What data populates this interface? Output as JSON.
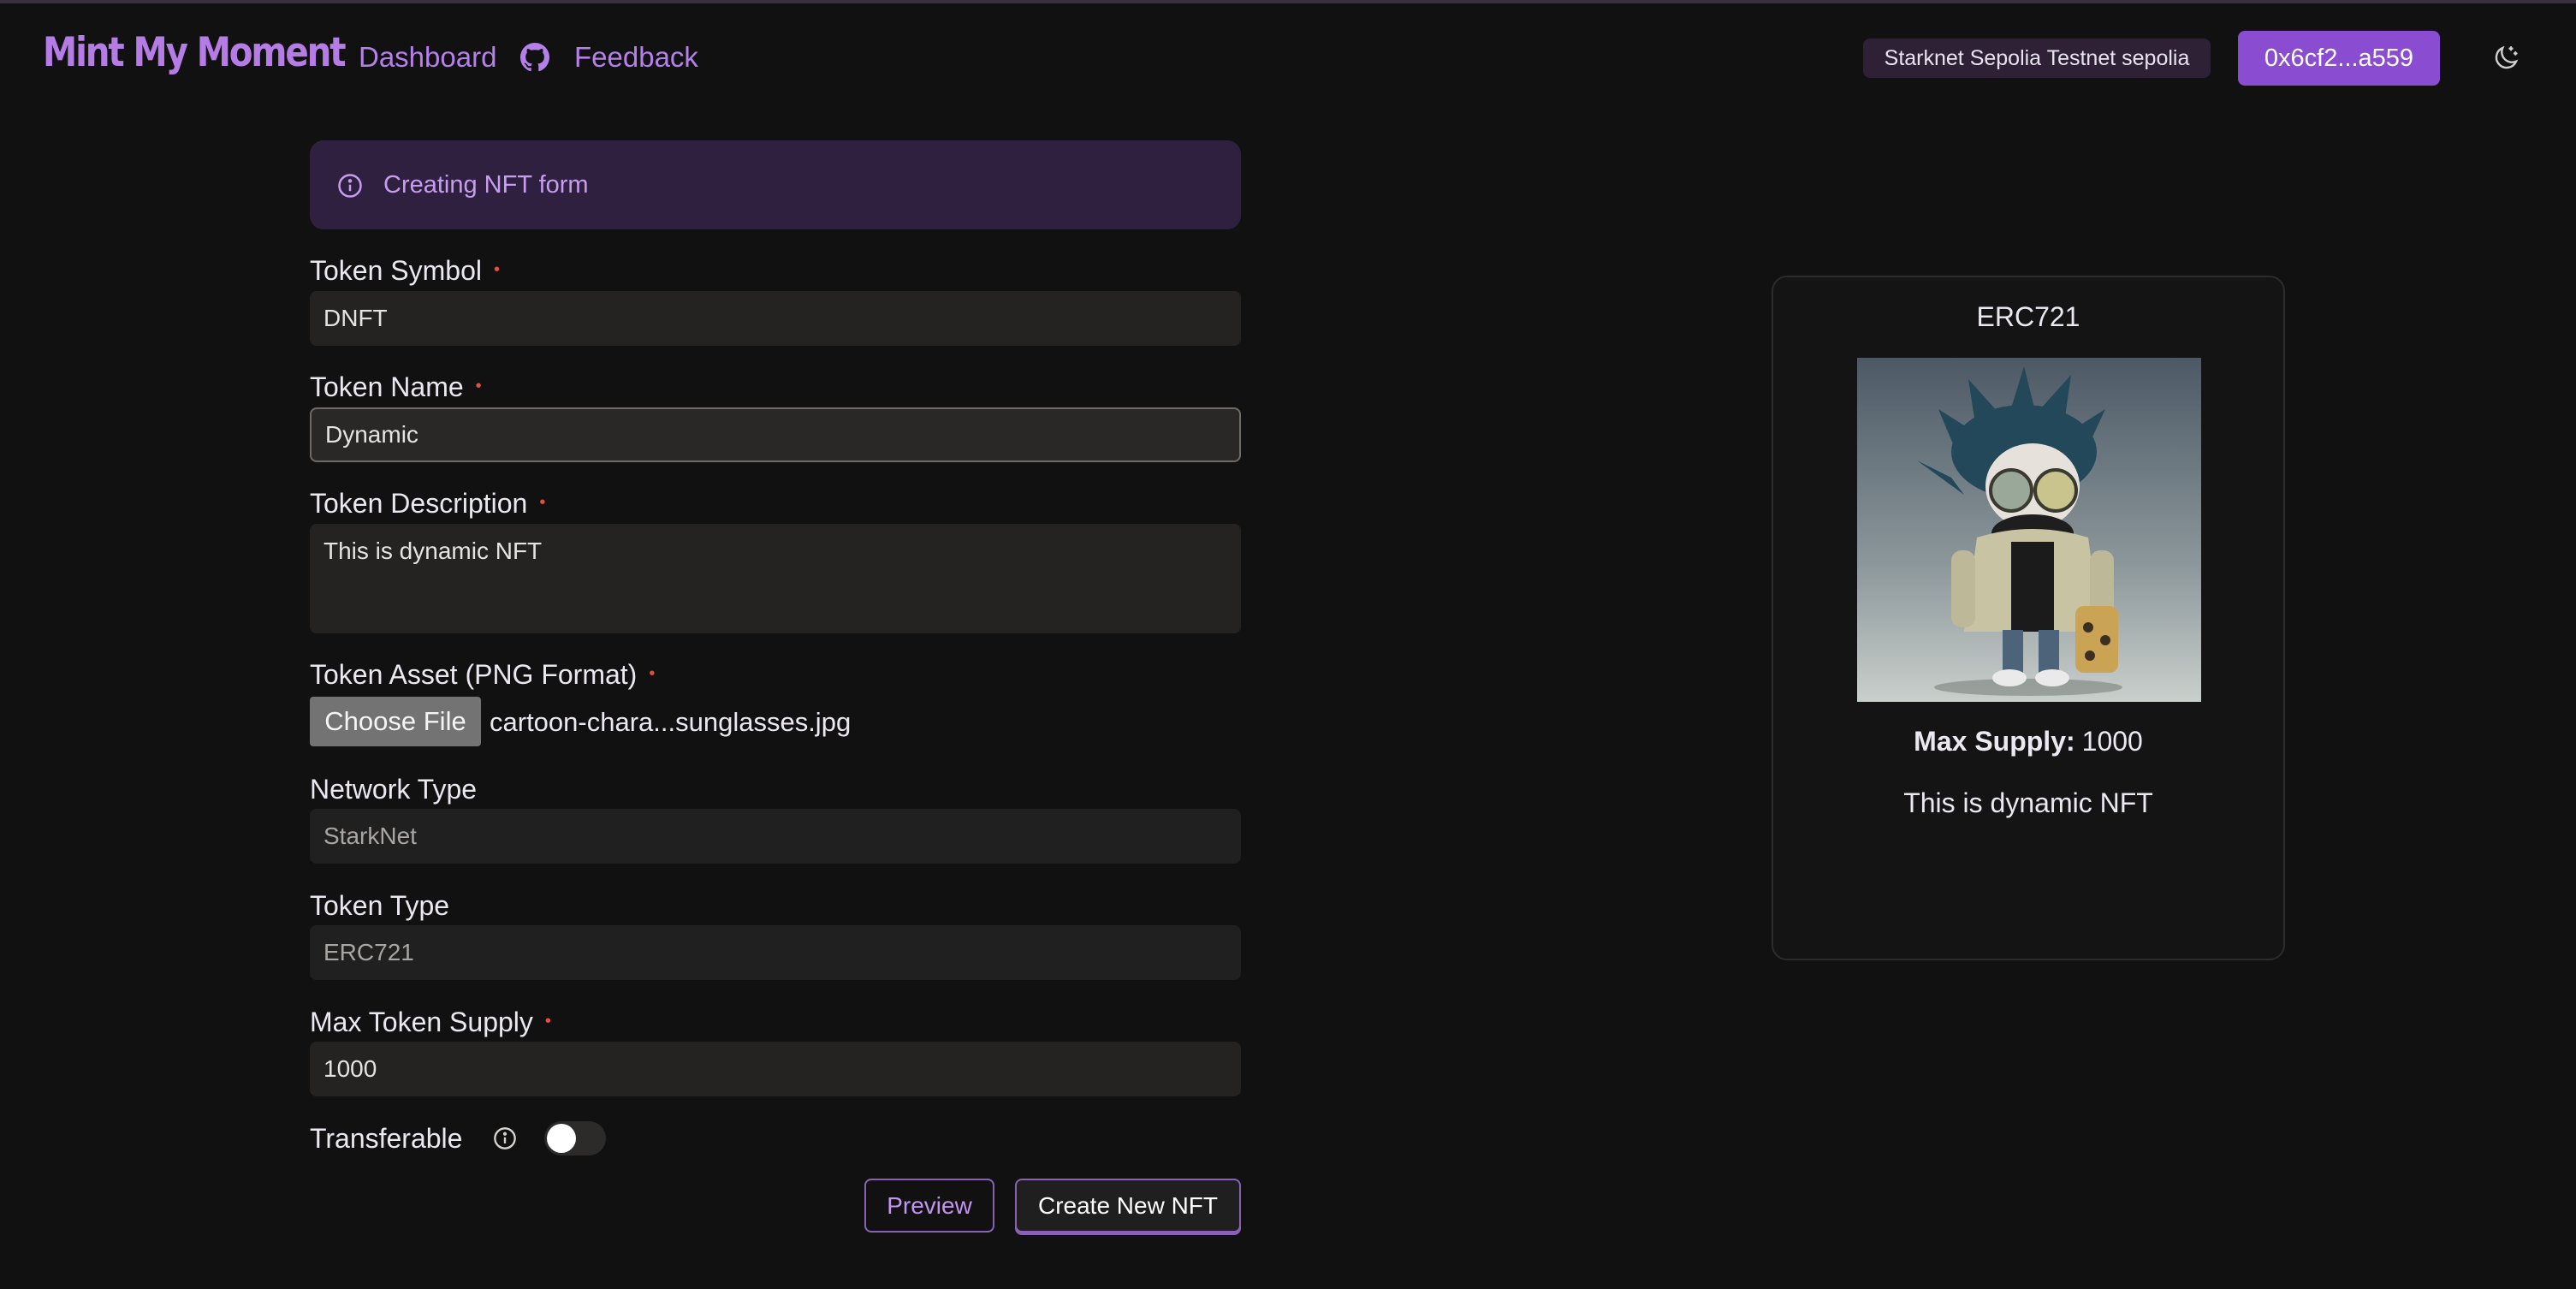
{
  "header": {
    "logo": "Mint My Moment",
    "nav": {
      "dashboard": "Dashboard",
      "feedback": "Feedback"
    },
    "network_badge": "Starknet Sepolia Testnet sepolia",
    "wallet_address": "0x6cf2...a559",
    "icons": {
      "github": "github-icon",
      "theme": "moon-icon"
    }
  },
  "form": {
    "alert": "Creating NFT form",
    "token_symbol": {
      "label": "Token Symbol",
      "value": "DNFT"
    },
    "token_name": {
      "label": "Token Name",
      "value": "Dynamic"
    },
    "token_description": {
      "label": "Token Description",
      "value": "This is dynamic NFT"
    },
    "token_asset": {
      "label": "Token Asset (PNG Format)",
      "button": "Choose File",
      "file_name": "cartoon-chara...sunglasses.jpg"
    },
    "network_type": {
      "label": "Network Type",
      "value": "StarkNet"
    },
    "token_type": {
      "label": "Token Type",
      "value": "ERC721"
    },
    "max_supply": {
      "label": "Max Token Supply",
      "value": "1000"
    },
    "transferable": {
      "label": "Transferable",
      "enabled": false
    },
    "required_mark": "•",
    "buttons": {
      "preview": "Preview",
      "create": "Create New NFT"
    }
  },
  "preview_card": {
    "title": "ERC721",
    "image": "cartoon character with sunglasses",
    "max_supply_label": "Max Supply:",
    "max_supply_value": "1000",
    "description": "This is dynamic NFT"
  },
  "colors": {
    "background": "#111111",
    "accent": "#b57ce6",
    "wallet_button": "#8a4cd0",
    "alert_bg": "#2f2040",
    "required": "#e0503e"
  }
}
